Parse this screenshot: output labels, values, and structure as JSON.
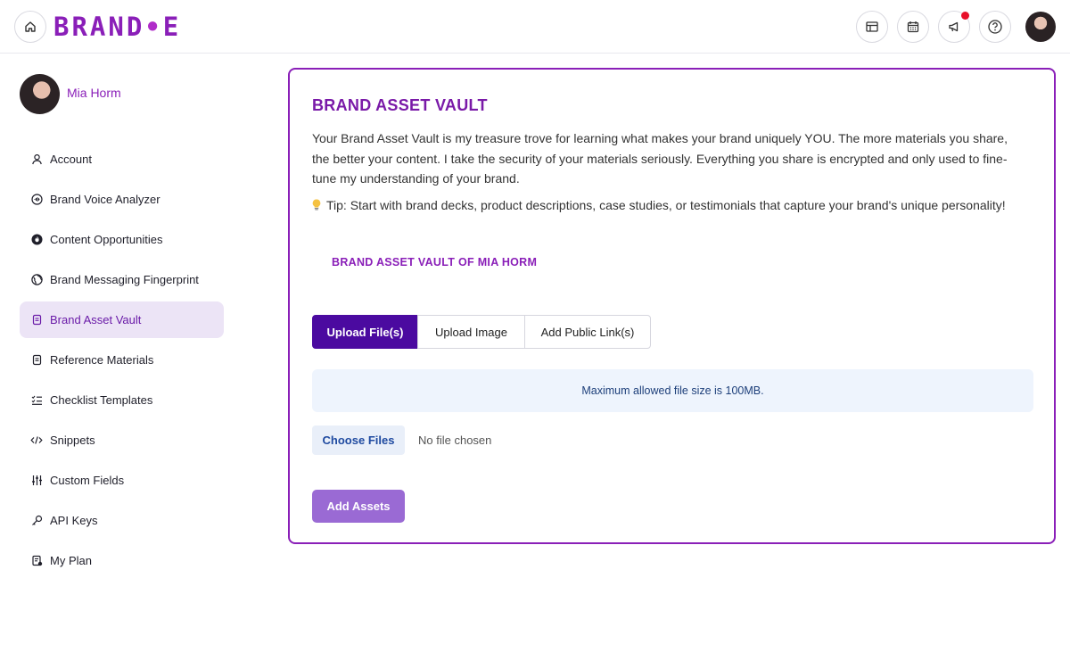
{
  "header": {
    "logo_text": "BRAND",
    "logo_dot": "•",
    "logo_suffix": "E",
    "icons": [
      "home-icon",
      "layout-icon",
      "calendar-icon",
      "megaphone-icon",
      "help-icon",
      "avatar"
    ]
  },
  "sidebar": {
    "user_name": "Mia Horm",
    "items": [
      {
        "label": "Account",
        "icon": "user-icon"
      },
      {
        "label": "Brand Voice Analyzer",
        "icon": "voice-icon"
      },
      {
        "label": "Content Opportunities",
        "icon": "opportunity-icon"
      },
      {
        "label": "Brand Messaging Fingerprint",
        "icon": "globe-icon"
      },
      {
        "label": "Brand Asset Vault",
        "icon": "vault-icon",
        "active": true
      },
      {
        "label": "Reference Materials",
        "icon": "document-icon"
      },
      {
        "label": "Checklist Templates",
        "icon": "checklist-icon"
      },
      {
        "label": "Snippets",
        "icon": "code-icon"
      },
      {
        "label": "Custom Fields",
        "icon": "sliders-icon"
      },
      {
        "label": "API Keys",
        "icon": "key-icon"
      },
      {
        "label": "My Plan",
        "icon": "plan-icon"
      }
    ]
  },
  "main": {
    "title": "BRAND ASSET VAULT",
    "description": "Your Brand Asset Vault is my treasure trove for learning what makes your brand uniquely YOU. The more materials you share, the better your content. I take the security of your materials seriously. Everything you share is encrypted and only used to fine-tune my understanding of your brand.",
    "tip": "Tip: Start with brand decks, product descriptions, case studies, or testimonials that capture your brand's unique personality!",
    "vault_of": "BRAND ASSET VAULT OF MIA HORM",
    "tabs": [
      {
        "label": "Upload File(s)",
        "active": true
      },
      {
        "label": "Upload Image"
      },
      {
        "label": "Add Public Link(s)"
      }
    ],
    "max_size_note": "Maximum allowed file size is 100MB.",
    "choose_files_label": "Choose Files",
    "no_file_text": "No file chosen",
    "add_assets_label": "Add Assets"
  },
  "colors": {
    "brand": "#8a1fb8",
    "tab_active": "#4b0aa0",
    "add_button": "#9a6ad4",
    "notification": "#e8102a"
  }
}
